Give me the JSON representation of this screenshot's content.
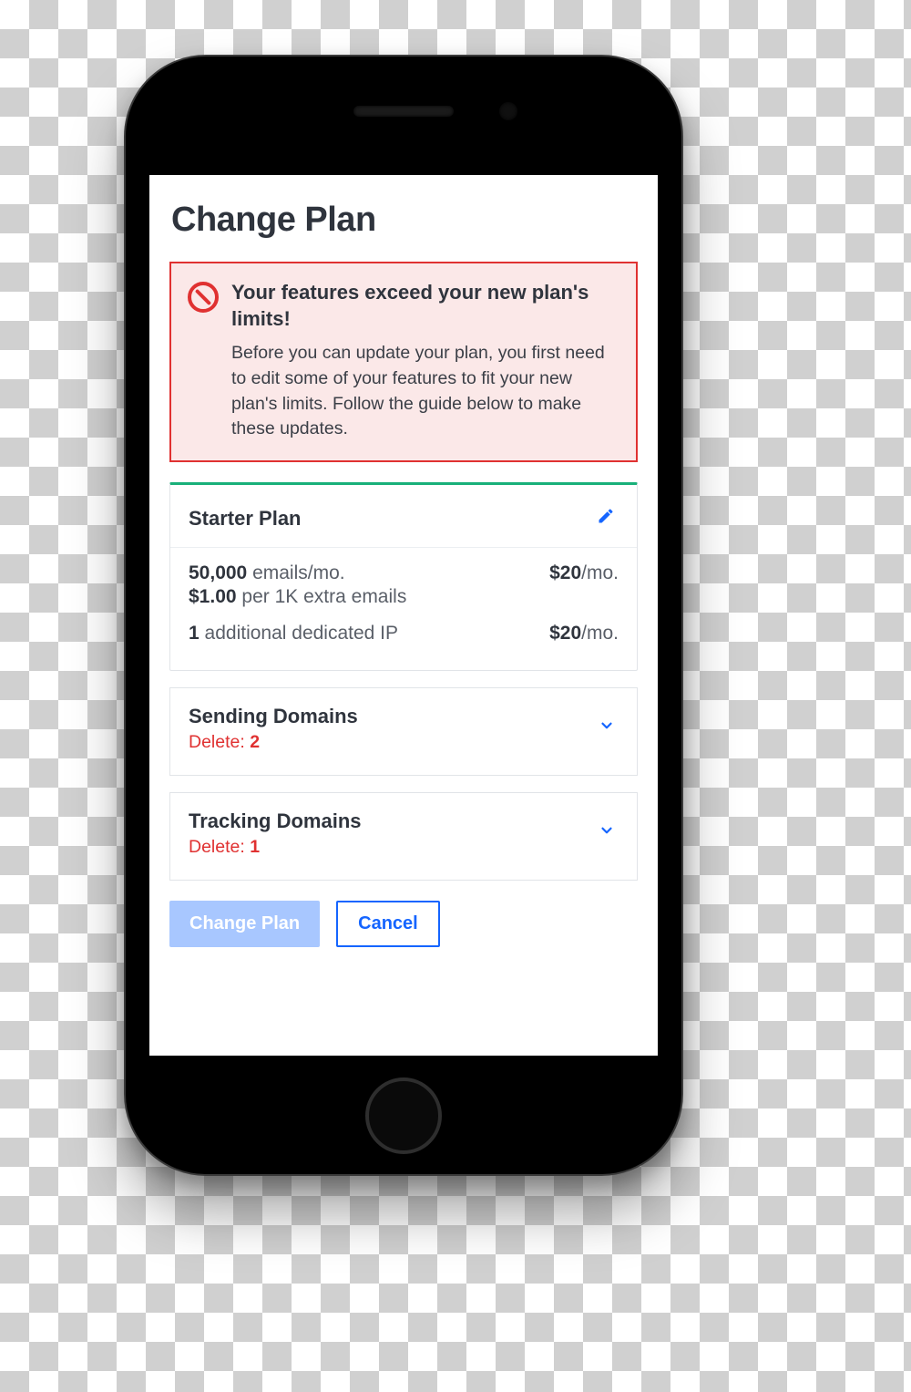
{
  "page": {
    "title": "Change Plan"
  },
  "alert": {
    "title": "Your features exceed your new plan's limits!",
    "body": "Before you can update your plan, you first need to edit some of your features to fit your new plan's limits. Follow the guide below to make these updates."
  },
  "plan": {
    "name": "Starter Plan",
    "emails_count": "50,000",
    "emails_unit": "emails/mo.",
    "emails_price_amount": "$20",
    "emails_price_unit": "/mo.",
    "overage_price": "$1.00",
    "overage_unit": "per 1K extra emails",
    "ip_count": "1",
    "ip_label": "additional dedicated IP",
    "ip_price_amount": "$20",
    "ip_price_unit": "/mo."
  },
  "panels": {
    "sending": {
      "title": "Sending Domains",
      "delete_prefix": "Delete: ",
      "delete_count": "2"
    },
    "tracking": {
      "title": "Tracking Domains",
      "delete_prefix": "Delete: ",
      "delete_count": "1"
    }
  },
  "actions": {
    "primary": "Change Plan",
    "secondary": "Cancel"
  }
}
